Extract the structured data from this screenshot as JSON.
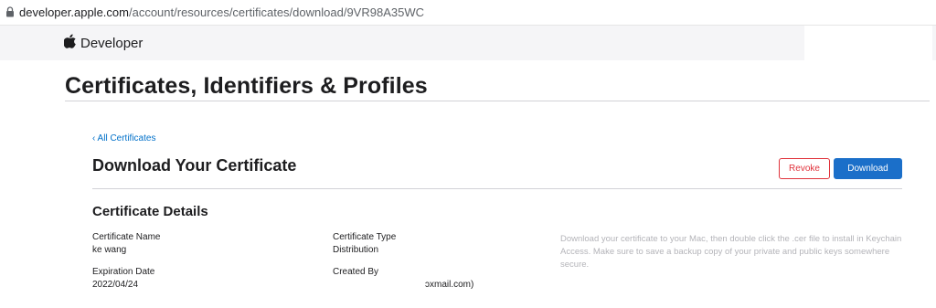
{
  "browser": {
    "url_host": "developer.apple.com",
    "url_path": "/account/resources/certificates/download/9VR98A35WC"
  },
  "header": {
    "brand": "Developer",
    "logo_icon": "apple-logo-icon"
  },
  "page": {
    "title": "Certificates, Identifiers & Profiles"
  },
  "certificate": {
    "back_link": "‹ All Certificates",
    "heading": "Download Your Certificate",
    "revoke_label": "Revoke",
    "download_label": "Download",
    "details_heading": "Certificate Details",
    "fields": {
      "name_label": "Certificate Name",
      "name_value": "ke wang",
      "type_label": "Certificate Type",
      "type_value": "Distribution",
      "expiration_label": "Expiration Date",
      "expiration_value": "2022/04/24",
      "created_by_label": "Created By",
      "created_by_value": "ɔxmail.com)"
    },
    "help_text": "Download your certificate to your Mac, then double click the .cer file to install in Keychain Access. Make sure to save a backup copy of your private and public keys somewhere secure."
  },
  "colors": {
    "link": "#0070c9",
    "revoke": "#e0323b",
    "primary_button": "#1b6fc9",
    "header_bg": "#f5f5f7"
  }
}
